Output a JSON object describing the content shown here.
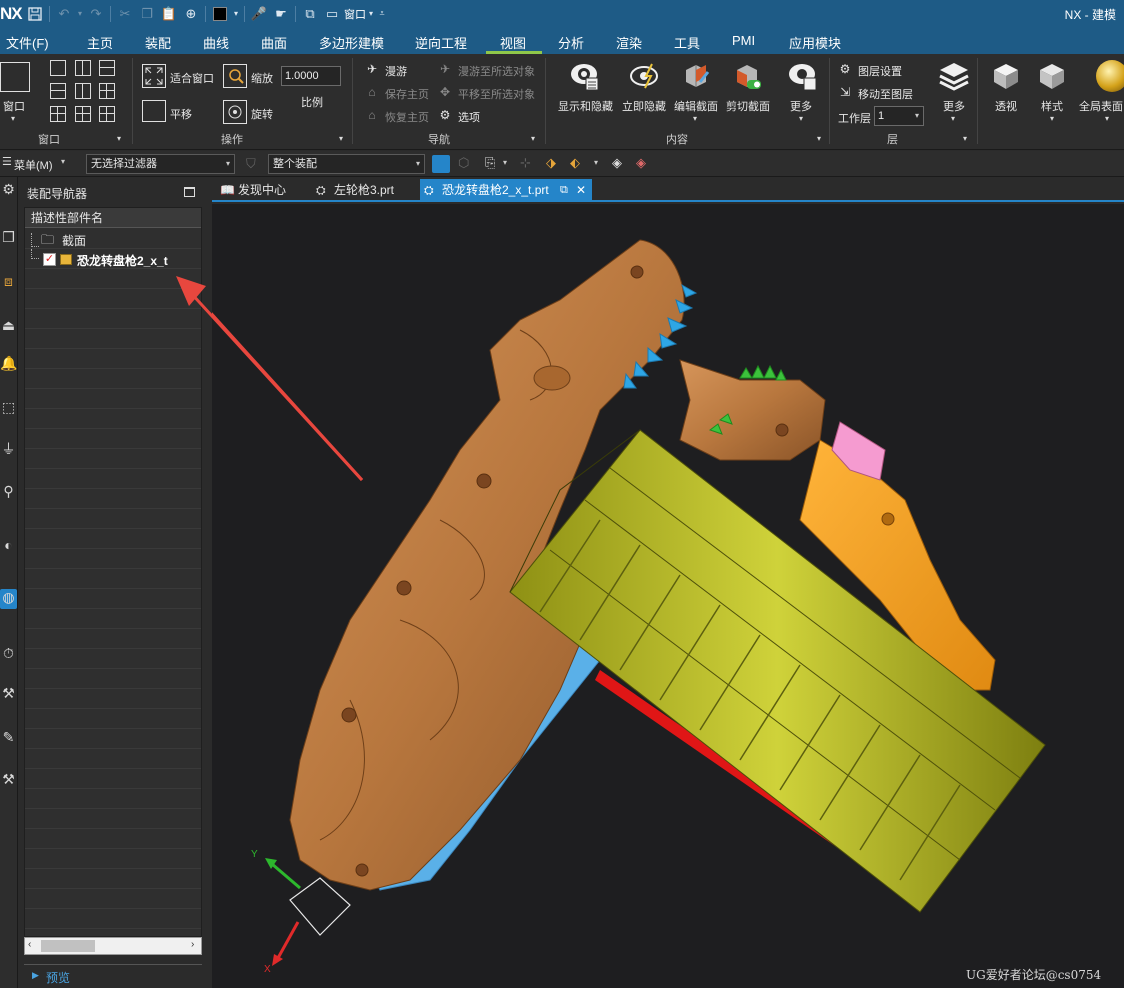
{
  "app": {
    "logo": "NX",
    "title": "NX - 建模",
    "window_label": "窗口"
  },
  "menu": {
    "items": [
      "文件(F)",
      "主页",
      "装配",
      "曲线",
      "曲面",
      "多边形建模",
      "逆向工程",
      "视图",
      "分析",
      "渲染",
      "工具",
      "PMI",
      "应用模块"
    ],
    "active": "视图"
  },
  "ribbon": {
    "window_group": {
      "window_label": "窗口",
      "group_label": "窗口"
    },
    "operate_group": {
      "fit_window": "适合窗口",
      "pan": "平移",
      "zoom": "缩放",
      "rotate": "旋转",
      "scale_value": "1.0000",
      "scale_label": "比例",
      "group_label": "操作"
    },
    "nav_group": {
      "roam": "漫游",
      "save_home": "保存主页",
      "restore_home": "恢复主页",
      "roam_to_selected": "漫游至所选对象",
      "pan_to_selected": "平移至所选对象",
      "options": "选项",
      "group_label": "导航"
    },
    "content_group": {
      "show_hide": "显示和隐藏",
      "hide_now": "立即隐藏",
      "edit_section": "编辑截面",
      "clip_section": "剪切截面",
      "more": "更多",
      "group_label": "内容"
    },
    "layer_group": {
      "layer_settings": "图层设置",
      "move_to_layer": "移动至图层",
      "work_layer_label": "工作层",
      "work_layer_value": "1",
      "more": "更多",
      "group_label": "层"
    },
    "style_group": {
      "perspective": "透视",
      "style": "样式",
      "global_surface": "全局表面"
    }
  },
  "toolbar2": {
    "menu_label": "菜单(M)",
    "filter": "无选择过滤器",
    "assembly_scope": "整个装配"
  },
  "navigator": {
    "title": "装配导航器",
    "column_header": "描述性部件名",
    "rows": [
      {
        "label": "截面",
        "type": "folder"
      },
      {
        "label": "恐龙转盘枪2_x_t",
        "type": "part",
        "checked": true
      }
    ],
    "preview_label": "预览"
  },
  "tabs": [
    {
      "label": "发现中心",
      "active": false
    },
    {
      "label": "左轮枪3.prt",
      "active": false
    },
    {
      "label": "恐龙转盘枪2_x_t.prt",
      "active": true
    }
  ],
  "viewport": {
    "axis_y": "Y",
    "axis_x": "X",
    "watermark": "UG爱好者论坛@cs0754"
  },
  "colors": {
    "title_bar": "#1e5b86",
    "active_tab": "#2585c9",
    "menu_active_underline": "#8fc74a",
    "model_body": "#b8773e",
    "drum": "#b5b81f",
    "teeth": "#2ea6e6",
    "annotation_arrow": "#e8473e"
  }
}
